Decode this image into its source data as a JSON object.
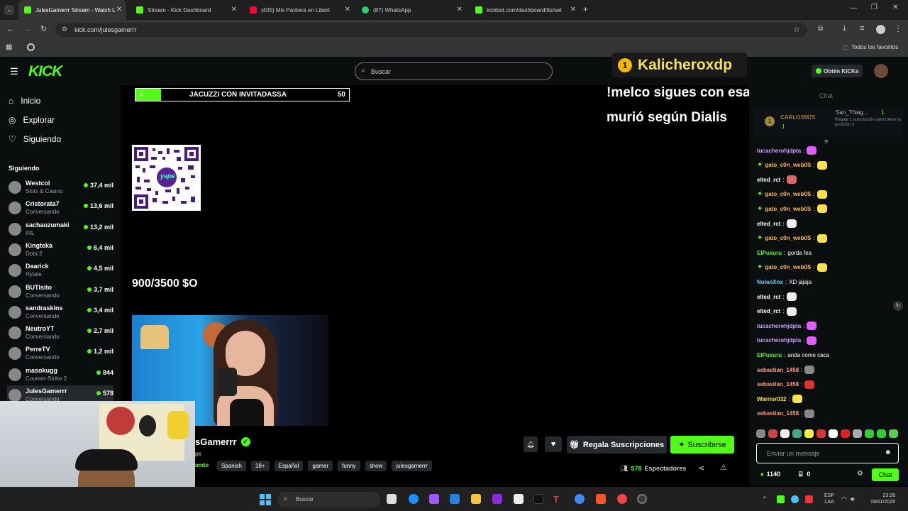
{
  "browser": {
    "tabs": [
      {
        "label": "JulesGamerrr Stream - Watch L",
        "active": true,
        "color": "#53fc18"
      },
      {
        "label": "Stream - Kick Dashboard",
        "active": false,
        "color": "#53fc18"
      },
      {
        "label": "(405) Mix Pantera en Libert",
        "active": false,
        "color": "#ff0033"
      },
      {
        "label": "(87) WhatsApp",
        "active": false,
        "color": "#25d366"
      },
      {
        "label": "kickbot.com/dashboard/tts/set",
        "active": false,
        "color": "#53fc18"
      }
    ],
    "url": "kick.com/julesgamerrr",
    "bookmarks_label": "Todos los favoritos"
  },
  "kick": {
    "logo": "KICK",
    "search_placeholder": "Buscar",
    "get_kicks": "Obtén KICKs",
    "nav": [
      {
        "label": "Inicio",
        "icon": "home-icon"
      },
      {
        "label": "Explorar",
        "icon": "compass-icon"
      },
      {
        "label": "Siguiendo",
        "icon": "heart-icon"
      }
    ],
    "following_title": "Siguiendo",
    "channels": [
      {
        "name": "Westcol",
        "category": "Slots & Casino",
        "viewers": "37,4 mil"
      },
      {
        "name": "Cristorata7",
        "category": "Conversando",
        "viewers": "13,6 mil"
      },
      {
        "name": "sachauzumaki",
        "category": "IRL",
        "viewers": "13,2 mil"
      },
      {
        "name": "Kingteka",
        "category": "Dota 2",
        "viewers": "6,4 mil"
      },
      {
        "name": "Daarick",
        "category": "Hytale",
        "viewers": "4,5 mil"
      },
      {
        "name": "BUTIsito",
        "category": "Conversando",
        "viewers": "3,7 mil"
      },
      {
        "name": "sandraskins",
        "category": "Conversando",
        "viewers": "3,4 mil"
      },
      {
        "name": "NeutroYT",
        "category": "Conversando",
        "viewers": "2,7 mil"
      },
      {
        "name": "PerreTV",
        "category": "Conversando",
        "viewers": "1,2 mil"
      },
      {
        "name": "masokugg",
        "category": "Counter-Strike 2",
        "viewers": "844"
      },
      {
        "name": "JulesGamerrr",
        "category": "Conversando",
        "viewers": "578"
      }
    ]
  },
  "overlay": {
    "goal_badge": "6",
    "goal_text": "JACUZZI CON INVITADASSA",
    "goal_value": "50",
    "goal_progress": 0.12,
    "money_goal": "900/3500 $O",
    "qr_label": "yape",
    "tts_user_rank": "1",
    "tts_user": "Kalicheroxdp",
    "tts_message": "!melco sigues con esa huevada que kick murió según Dialis"
  },
  "stream": {
    "channel_name": "sGamerrr",
    "subtitle": "pe",
    "live_label": "ando",
    "tags": [
      "Spanish",
      "18+",
      "Español",
      "gamer",
      "funny",
      "show",
      "julesgamerrr"
    ],
    "gift_button": "Regala Suscripciones",
    "subscribe_button": "Suscribirse",
    "viewers_count": "578",
    "viewers_label": "Espectadores"
  },
  "chat": {
    "header": "Chat",
    "leaderboard": [
      {
        "rank": "1",
        "name": "CARLOSM75",
        "amount": "1"
      },
      {
        "name": "San_Thiag...",
        "amount": "1",
        "note": "Regala 1 suscripción para tomar la posición 3"
      }
    ],
    "messages": [
      {
        "user": "tucacherohjdpta",
        "text": "",
        "color": "#c9a0ff",
        "emote": "#e05dff",
        "badge": false
      },
      {
        "user": "gato_c0n_web0S",
        "text": "",
        "color": "#ffb84d",
        "emote": "#ffe14d",
        "badge": true
      },
      {
        "user": "elted_rct",
        "text": "",
        "color": "#ffffff",
        "emote": "#d96a6a",
        "badge": false
      },
      {
        "user": "gato_c0n_web0S",
        "text": "",
        "color": "#ffb84d",
        "emote": "#ffe14d",
        "badge": true
      },
      {
        "user": "gato_c0n_web0S",
        "text": "",
        "color": "#ffb84d",
        "emote": "#ffe14d",
        "badge": true
      },
      {
        "user": "elted_rct",
        "text": "",
        "color": "#ffffff",
        "emote": "#eeeeee",
        "badge": false
      },
      {
        "user": "gato_c0n_web0S",
        "text": "",
        "color": "#ffb84d",
        "emote": "#ffe14d",
        "badge": true
      },
      {
        "user": "ElPuxuru",
        "text": "gorda fea",
        "color": "#53fc18",
        "emote": "",
        "badge": false
      },
      {
        "user": "gato_c0n_web0S",
        "text": "",
        "color": "#ffb84d",
        "emote": "#ffe14d",
        "badge": true
      },
      {
        "user": "NolanXnx",
        "text": "XD jajaja",
        "color": "#6bd0ff",
        "emote": "",
        "badge": false
      },
      {
        "user": "elted_rct",
        "text": "",
        "color": "#ffffff",
        "emote": "#eeeeee",
        "badge": false
      },
      {
        "user": "elted_rct",
        "text": "",
        "color": "#ffffff",
        "emote": "#eeeeee",
        "badge": false
      },
      {
        "user": "tucacherohjdpta",
        "text": "",
        "color": "#c9a0ff",
        "emote": "#e05dff",
        "badge": false
      },
      {
        "user": "tucacherohjdpta",
        "text": "",
        "color": "#c9a0ff",
        "emote": "#e05dff",
        "badge": false
      },
      {
        "user": "ElPuxuru",
        "text": "anda come caca",
        "color": "#53fc18",
        "emote": "",
        "badge": false
      },
      {
        "user": "sebastian_1458",
        "text": "",
        "color": "#ff9e80",
        "emote": "#888888",
        "badge": false
      },
      {
        "user": "sebastian_1458",
        "text": "",
        "color": "#ff9e80",
        "emote": "#d33",
        "badge": false
      },
      {
        "user": "Warrior032",
        "text": "",
        "color": "#ffe14d",
        "emote": "#ffe14d",
        "badge": false
      },
      {
        "user": "sebastian_1458",
        "text": "",
        "color": "#ff9e80",
        "emote": "#888888",
        "badge": false
      }
    ],
    "input_placeholder": "Enviar un mensaje",
    "kicks_balance": "1140",
    "store_count": "0",
    "chat_button": "Chat"
  },
  "taskbar": {
    "search_placeholder": "Buscar",
    "lang": "ESP",
    "lang2": "LAA",
    "time": "23:26",
    "date": "19/01/2026"
  },
  "colors": {
    "accent": "#53fc18",
    "bg": "#0b0e0f",
    "panel": "#26292b"
  }
}
